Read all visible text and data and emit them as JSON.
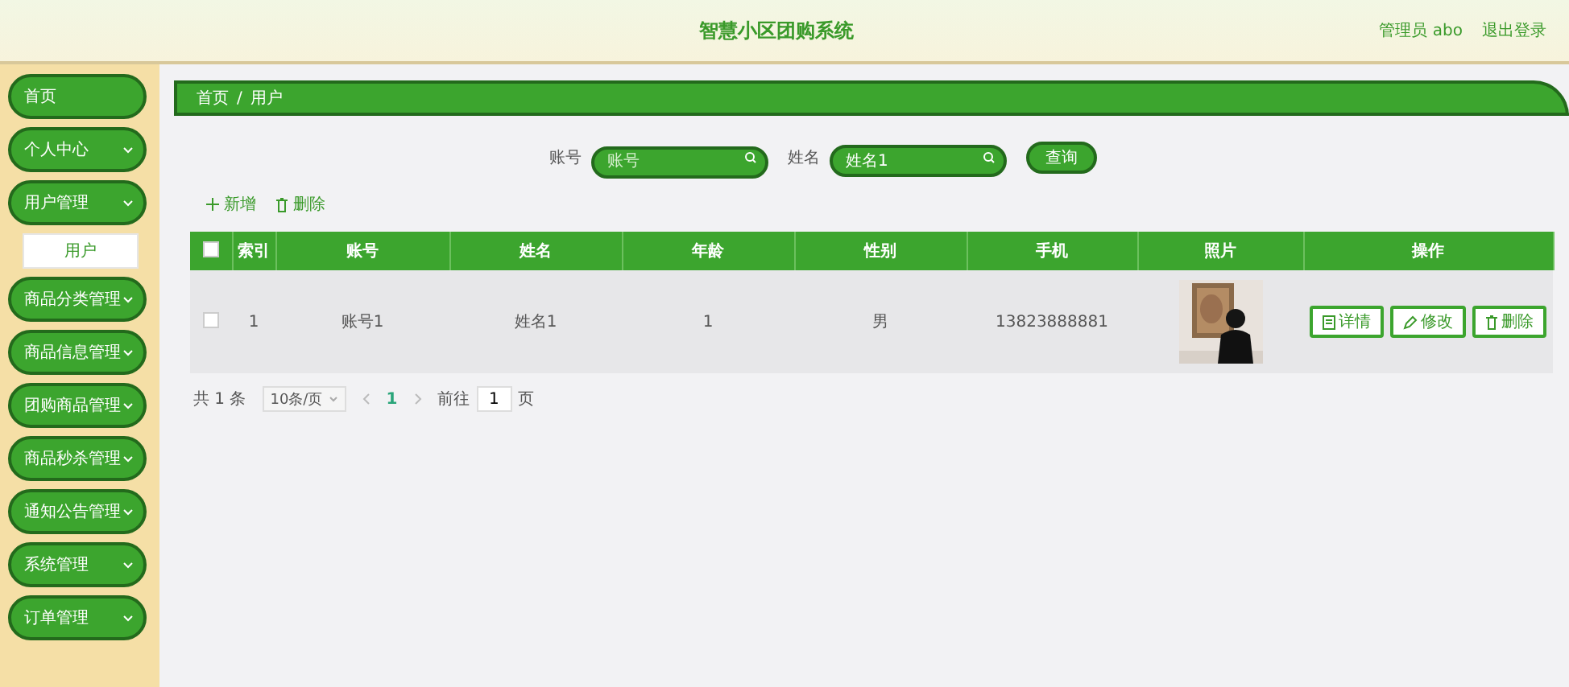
{
  "header": {
    "title": "智慧小区团购系统",
    "user": "管理员 abo",
    "logout": "退出登录"
  },
  "sidebar": {
    "items": [
      {
        "label": "首页",
        "kind": "link"
      },
      {
        "label": "个人中心",
        "kind": "submenu"
      },
      {
        "label": "用户管理",
        "kind": "submenu",
        "children": [
          {
            "label": "用户"
          }
        ]
      },
      {
        "label": "商品分类管理",
        "kind": "submenu"
      },
      {
        "label": "商品信息管理",
        "kind": "submenu"
      },
      {
        "label": "团购商品管理",
        "kind": "submenu"
      },
      {
        "label": "商品秒杀管理",
        "kind": "submenu"
      },
      {
        "label": "通知公告管理",
        "kind": "submenu"
      },
      {
        "label": "系统管理",
        "kind": "submenu"
      },
      {
        "label": "订单管理",
        "kind": "submenu"
      }
    ]
  },
  "breadcrumb": [
    "首页",
    "用户"
  ],
  "breadcrumb_separator": "/",
  "search": {
    "fields": [
      {
        "label": "账号",
        "placeholder": "账号"
      },
      {
        "label": "姓名",
        "value": "姓名1"
      }
    ],
    "button": "查询"
  },
  "actions": [
    {
      "label": "新增",
      "kind": "add"
    },
    {
      "label": "删除",
      "kind": "delete"
    }
  ],
  "table": {
    "select_all_checked": false,
    "columns": [
      "索引",
      "账号",
      "姓名",
      "年龄",
      "性别",
      "手机",
      "照片",
      "操作"
    ],
    "rows": [
      {
        "checked": false,
        "cells": [
          "1",
          "账号1",
          "姓名1",
          "1",
          "男",
          "13823888881"
        ],
        "buttons": [
          {
            "label": "详情",
            "kind": "detail"
          },
          {
            "label": "修改",
            "kind": "edit"
          },
          {
            "label": "删除",
            "kind": "delete"
          }
        ]
      }
    ]
  },
  "pagination": {
    "total": "共 1 条",
    "page_size": "10条/页",
    "pages": [
      {
        "label": "1",
        "selected": true
      }
    ],
    "goto_label": "前往",
    "goto_value": "1",
    "goto_suffix": "页"
  }
}
